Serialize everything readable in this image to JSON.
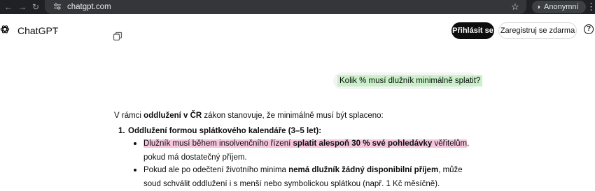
{
  "browser": {
    "url": "chatgpt.com",
    "profile_label": "Anonymní"
  },
  "header": {
    "app_title": "ChatGPT",
    "login_label": "Přihlásit se",
    "signup_label": "Zaregistruj se zdarma",
    "help_label": "?"
  },
  "conversation": {
    "user_message": "Kolik % musí dlužník minimálně splatit?",
    "answer": {
      "intro_prefix": "V rámci ",
      "intro_bold": "oddlužení v ČR",
      "intro_suffix": " zákon stanovuje, že minimálně musí být splaceno:",
      "item_1_number": "1.",
      "item_1_title": "Oddlužení formou splátkového kalendáře",
      "item_1_suffix": " (3–5 let):",
      "bullet_1_hl_a": "Dlužník musí během insolvenčního řízení ",
      "bullet_1_hl_bold": "splatit alespoň 30 % své pohledávky",
      "bullet_1_hl_b": " věřitelům",
      "bullet_1_rest": ", pokud má dostatečný příjem.",
      "bullet_2_a": "Pokud ale po odečtení životního minima ",
      "bullet_2_bold": "nemá dlužník žádný disponibilní příjem",
      "bullet_2_b": ", může soud schválit oddlužení i s menší nebo symbolickou splátkou (např. 1 Kč měsíčně)."
    }
  },
  "colors": {
    "browser_bg": "#202124",
    "url_box_bg": "#35363a",
    "user_highlight": "#c9f0c9",
    "answer_highlight": "#f4c6dd",
    "login_button_bg": "#0d0d0d"
  }
}
